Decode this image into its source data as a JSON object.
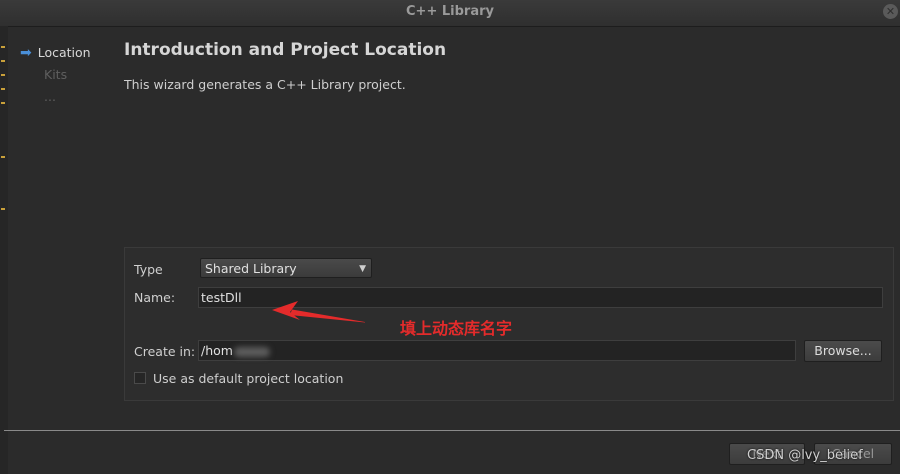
{
  "window": {
    "title": "C++ Library"
  },
  "sidebar": {
    "steps": [
      {
        "label": "Location",
        "active": true
      },
      {
        "label": "Kits",
        "active": false
      },
      {
        "label": "...",
        "active": false
      }
    ]
  },
  "page": {
    "heading": "Introduction and Project Location",
    "description": "This wizard generates a C++ Library project."
  },
  "form": {
    "type_label": "Type",
    "type_value": "Shared Library",
    "name_label": "Name:",
    "name_value": "testDll",
    "create_in_label": "Create in:",
    "create_in_value": "/hom",
    "browse_label": "Browse...",
    "default_location_label": "Use as default project location",
    "default_location_checked": false
  },
  "annotation": {
    "text": "填上动态库名字",
    "color": "#e42b2b"
  },
  "footer": {
    "next_label": "Next",
    "cancel_label": "Cancel",
    "watermark": "CSDN @lvy_belief"
  }
}
